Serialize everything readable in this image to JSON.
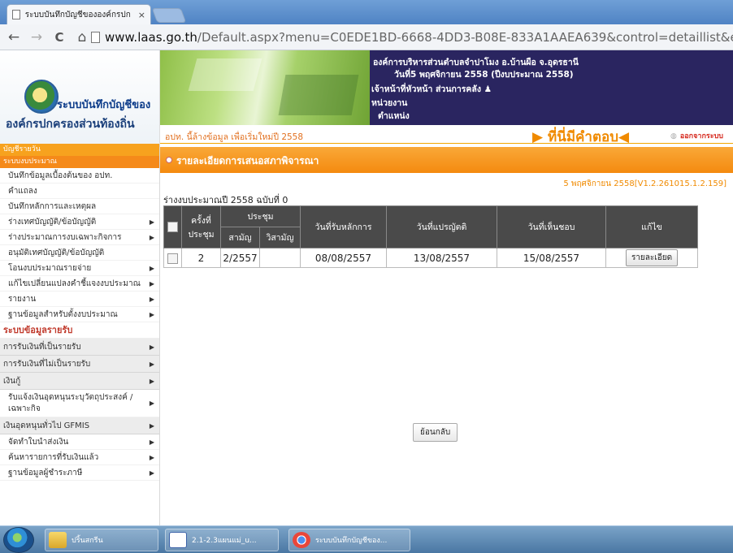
{
  "browser": {
    "tab_title": "ระบบบันทึกบัญชีขององค์กรปก",
    "tab_close": "×",
    "url_host": "www.laas.go.th",
    "url_rest": "/Default.aspx?menu=C0EDE1BD-6668-4DD3-B08E-833A1AAEA639&control=detaillist&editable=false&sid=",
    "nav_icons": [
      "back-arrow-icon",
      "forward-arrow-icon",
      "reload-icon",
      "home-icon"
    ],
    "back_glyph": "←",
    "forward_glyph": "→",
    "reload_glyph": "C",
    "home_glyph": "⌂"
  },
  "header": {
    "logo_title": "ระบบบันทึกบัญชีของ",
    "logo_subtitle": "องค์กรปกครองส่วนท้องถิ่น",
    "org_name": "องค์การบริหารส่วนตำบลจำปาโมง อ.บ้านผือ จ.อุดรธานี",
    "date_line": "วันที่5 พฤศจิกายน 2558  (ปีงบประมาณ 2558)",
    "officer": "เจ้าหน้าที่หัวหน้า ส่วนการคลัง",
    "unit_label": "หน่วยงาน",
    "position_label": "ตำแหน่ง",
    "notice": "อปท. นี้ล้างข้อมูล เพื่อเริ่มใหม่ปี 2558",
    "answer": "ที่นี่มีคำตอบ",
    "logout": "ออกจากระบบ"
  },
  "sidebar": {
    "head1": "บัญชีรายวัน",
    "head2": "ระบบงบประมาณ",
    "items": [
      {
        "label": "บันทึกข้อมูลเบื้องต้นของ อปท.",
        "arrow": false
      },
      {
        "label": "คำแถลง",
        "arrow": false
      },
      {
        "label": "บันทึกหลักการและเหตุผล",
        "arrow": false
      },
      {
        "label": "ร่างเทศบัญญัติ/ข้อบัญญัติ",
        "arrow": true
      },
      {
        "label": "ร่างประมาณการงบเฉพาะกิจการ",
        "arrow": true
      },
      {
        "label": "อนุมัติเทศบัญญัติ/ข้อบัญญัติ",
        "arrow": false
      },
      {
        "label": "โอนงบประมาณรายจ่าย",
        "arrow": true
      },
      {
        "label": "แก้ไขเปลี่ยนแปลงคำชี้แจงงบประมาณ",
        "arrow": true
      },
      {
        "label": "รายงาน",
        "arrow": true
      },
      {
        "label": "ฐานข้อมูลสำหรับตั้งงบประมาณ",
        "arrow": true
      }
    ],
    "section2": "ระบบข้อมูลรายรับ",
    "cats": [
      "การรับเงินที่เป็นรายรับ",
      "การรับเงินที่ไม่เป็นรายรับ",
      "เงินกู้"
    ],
    "tall_item": "รับแจ้งเงินอุดหนุนระบุวัตถุประสงค์ / เฉพาะกิจ",
    "cat4": "เงินอุดหนุนทั่วไป GFMIS",
    "items2": [
      "จัดทำใบนำส่งเงิน",
      "ค้นหารายการที่รับเงินแล้ว",
      "ฐานข้อมูลผู้ชำระภาษี"
    ],
    "arrow_glyph": "▶"
  },
  "main": {
    "section_title": "รายละเอียดการเสนอสภาพิจารณา",
    "version": "5 พฤศจิกายน 2558[V1.2.261015.1.2.159]",
    "budget_line": "ร่างงบประมาณปี 2558 ฉบับที่ 0",
    "table": {
      "headers": {
        "round": "ครั้งที่ ประชุม",
        "meeting": "ประชุม",
        "ordinary": "สามัญ",
        "extraordinary": "วิสามัญ",
        "principle_date": "วันที่รับหลักการ",
        "translation_date": "วันที่แปรญัตติ",
        "approval_date": "วันที่เห็นชอบ",
        "edit": "แก้ไข"
      },
      "rows": [
        {
          "round": "2",
          "ordinary": "2/2557",
          "extraordinary": "",
          "principle_date": "08/08/2557",
          "translation_date": "13/08/2557",
          "approval_date": "15/08/2557",
          "edit_button": "รายละเอียด"
        }
      ]
    },
    "back_button": "ย้อนกลับ"
  },
  "taskbar": {
    "items": [
      {
        "label": "ปริ้นสกรีน",
        "icon": "folder-icon"
      },
      {
        "label": "2.1-2.3แผนแม่_u...",
        "icon": "word-icon"
      },
      {
        "label": "ระบบบันทึกบัญชีของ...",
        "icon": "chrome-icon"
      }
    ]
  }
}
